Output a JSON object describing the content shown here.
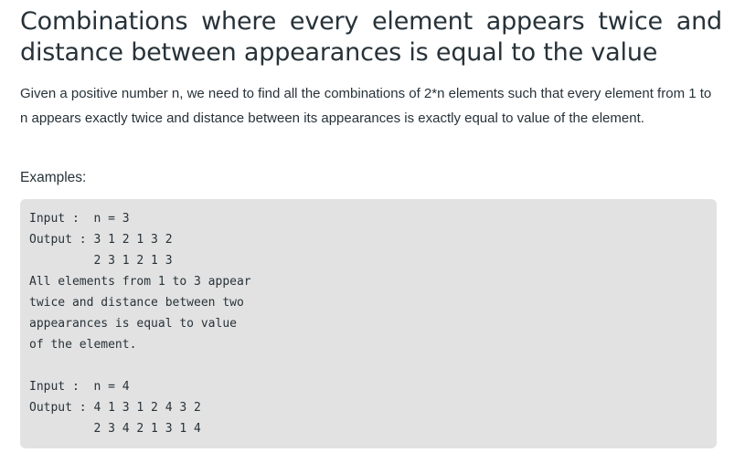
{
  "article": {
    "title": "Combinations where every element appears twice and distance between appearances is equal to the value",
    "description": "Given a positive number n, we need to find all the combinations of 2*n elements such that every element from 1 to n appears exactly twice and distance between its appearances is exactly equal to value of the element.",
    "examples_label": "Examples:",
    "code_lines": [
      "Input :  n = 3",
      "Output : 3 1 2 1 3 2",
      "         2 3 1 2 1 3",
      "All elements from 1 to 3 appear",
      "twice and distance between two",
      "appearances is equal to value",
      "of the element.",
      "",
      "Input :  n = 4",
      "Output : 4 1 3 1 2 4 3 2",
      "         2 3 4 2 1 3 1 4"
    ]
  }
}
